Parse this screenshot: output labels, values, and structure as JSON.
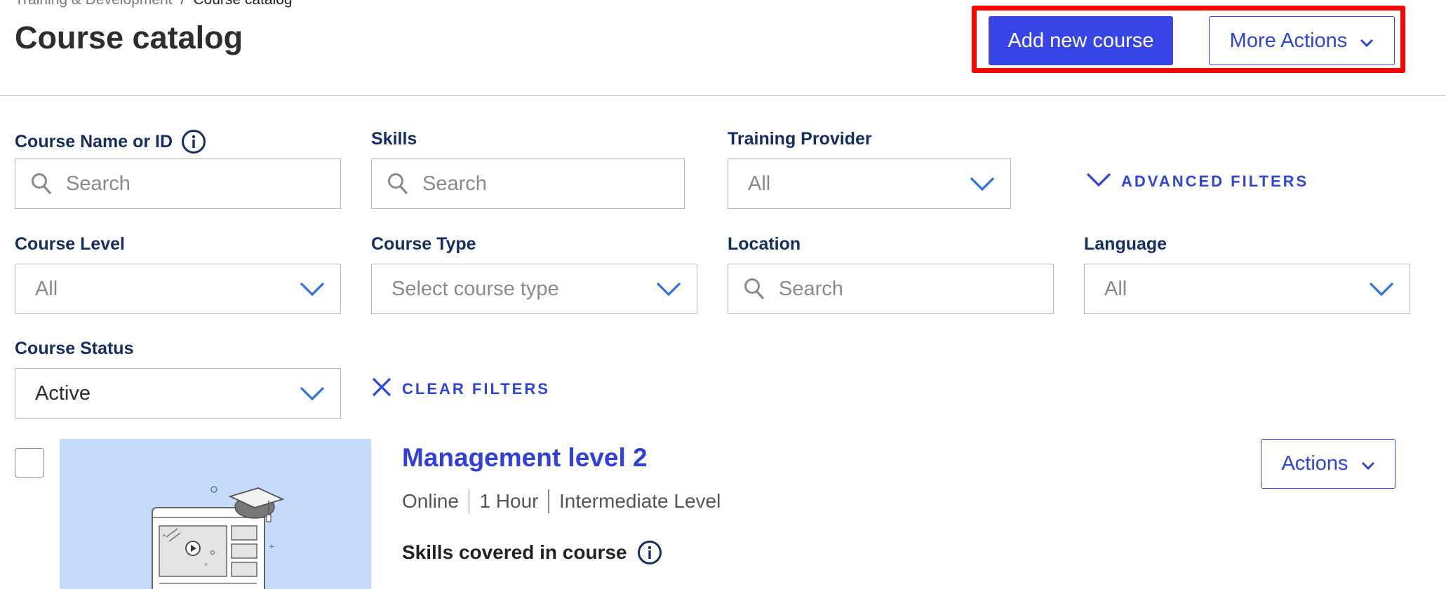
{
  "breadcrumb": {
    "parent": "Training & Development",
    "separator": "/",
    "current": "Course catalog"
  },
  "header": {
    "title": "Course catalog",
    "add_button": "Add new course",
    "more_actions_button": "More Actions"
  },
  "filters": {
    "course_name": {
      "label": "Course Name or ID",
      "placeholder": "Search"
    },
    "skills": {
      "label": "Skills",
      "placeholder": "Search"
    },
    "training_provider": {
      "label": "Training Provider",
      "value": "All"
    },
    "advanced_filters": "ADVANCED FILTERS",
    "course_level": {
      "label": "Course Level",
      "value": "All"
    },
    "course_type": {
      "label": "Course Type",
      "value": "Select course type"
    },
    "location": {
      "label": "Location",
      "placeholder": "Search"
    },
    "language": {
      "label": "Language",
      "value": "All"
    },
    "course_status": {
      "label": "Course Status",
      "value": "Active"
    },
    "clear_filters": "CLEAR FILTERS"
  },
  "courses": [
    {
      "title": "Management level 2",
      "delivery": "Online",
      "duration": "1 Hour",
      "level": "Intermediate Level",
      "skills_label": "Skills covered in course",
      "actions_label": "Actions"
    }
  ],
  "colors": {
    "primary": "#3744e6",
    "link": "#2f45d6",
    "label_navy": "#152e5f",
    "highlight": "#ff0000",
    "thumbnail_bg": "#c5dbfb"
  },
  "icons": [
    "info-icon",
    "search-icon",
    "chevron-down-icon",
    "close-icon"
  ]
}
